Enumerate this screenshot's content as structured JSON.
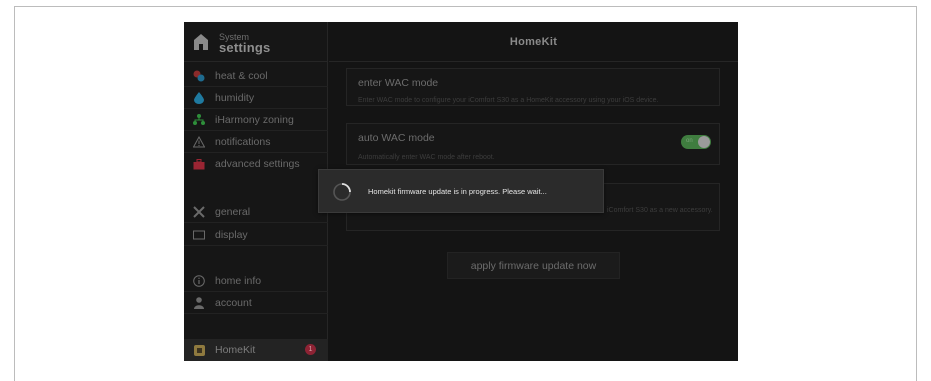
{
  "sidebar": {
    "brand": {
      "small": "System",
      "big": "settings",
      "icon": "house-icon"
    },
    "items": [
      {
        "label": "heat & cool",
        "icon": "heat-cool-icon"
      },
      {
        "label": "humidity",
        "icon": "humidity-drop-icon"
      },
      {
        "label": "iHarmony zoning",
        "icon": "zoning-icon"
      },
      {
        "label": "notifications",
        "icon": "warning-triangle-icon"
      },
      {
        "label": "advanced settings",
        "icon": "toolbox-icon"
      },
      {
        "label": "general",
        "icon": "tools-icon"
      },
      {
        "label": "display",
        "icon": "display-icon"
      },
      {
        "label": "home info",
        "icon": "info-icon"
      },
      {
        "label": "account",
        "icon": "person-icon"
      },
      {
        "label": "HomeKit",
        "icon": "homekit-icon",
        "badge": "1",
        "active": true
      }
    ]
  },
  "main": {
    "title": "HomeKit",
    "cards": [
      {
        "title": "enter WAC mode",
        "desc": "Enter WAC mode to configure your iComfort S30 as a HomeKit accessory using your iOS device."
      },
      {
        "title": "auto WAC mode",
        "desc": "Automatically enter WAC mode after reboot.",
        "toggle": "on"
      },
      {
        "desc": "iComfort S30 as a new accessory."
      }
    ],
    "apply_button": "apply firmware update now"
  },
  "dialog": {
    "message": "Homekit firmware update is in progress. Please wait..."
  },
  "colors": {
    "background": "#141414",
    "toggle_on": "#3f7d3f",
    "badge": "#8d2334",
    "dialog": "#2b2b2b"
  }
}
